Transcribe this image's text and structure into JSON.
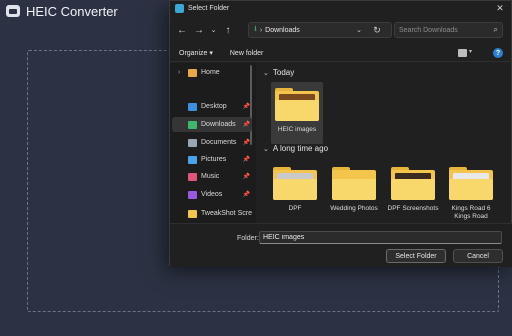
{
  "app": {
    "title": "HEIC Converter"
  },
  "dialog": {
    "title": "Select Folder",
    "address": {
      "current": "Downloads"
    },
    "search_placeholder": "Search Downloads",
    "toolbar": {
      "organize": "Organize ▾",
      "new_folder": "New folder"
    },
    "sidebar": {
      "items": [
        {
          "label": "Home",
          "icon": "home-icon",
          "color": "#e8a84a",
          "pinned": false
        },
        {
          "label": "Desktop",
          "icon": "desktop-icon",
          "color": "#3d8fe0",
          "pinned": true
        },
        {
          "label": "Downloads",
          "icon": "downloads-icon",
          "color": "#3fb56f",
          "pinned": true,
          "active": true
        },
        {
          "label": "Documents",
          "icon": "documents-icon",
          "color": "#9aa5b4",
          "pinned": true
        },
        {
          "label": "Pictures",
          "icon": "pictures-icon",
          "color": "#4aa3e8",
          "pinned": true
        },
        {
          "label": "Music",
          "icon": "music-icon",
          "color": "#e0557a",
          "pinned": true
        },
        {
          "label": "Videos",
          "icon": "videos-icon",
          "color": "#9a5ae0",
          "pinned": true
        },
        {
          "label": "TweakShot Scre",
          "icon": "folder-icon",
          "color": "#f3c54c",
          "pinned": false
        }
      ]
    },
    "groups": [
      {
        "label": "Today",
        "items": [
          {
            "label": "HEIC images",
            "selected": true,
            "preview": "#7a4a1e"
          }
        ]
      },
      {
        "label": "A long time ago",
        "items": [
          {
            "label": "DPF",
            "selected": false,
            "preview": "#c9c9c9"
          },
          {
            "label": "Wedding Photos",
            "selected": false,
            "preview": ""
          },
          {
            "label": "DPF Screenshots",
            "selected": false,
            "preview": "#3a2a20"
          },
          {
            "label": "Kings Road 6 Kings Road",
            "selected": false,
            "preview": "#e8e8e8"
          }
        ]
      }
    ],
    "footer": {
      "folder_label": "Folder:",
      "folder_value": "HEIC images",
      "select_button": "Select Folder",
      "cancel_button": "Cancel"
    }
  }
}
